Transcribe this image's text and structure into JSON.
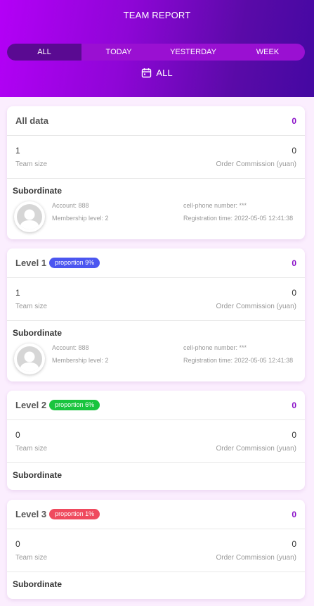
{
  "header": {
    "title": "TEAM REPORT",
    "tabs": [
      {
        "label": "ALL",
        "active": true
      },
      {
        "label": "TODAY",
        "active": false
      },
      {
        "label": "YESTERDAY",
        "active": false
      },
      {
        "label": "WEEK",
        "active": false
      }
    ],
    "date_filter": {
      "icon": "calendar-icon",
      "label": "ALL"
    }
  },
  "colors": {
    "accent": "#8a10c8",
    "level1_badge": "#4b56f0",
    "level2_badge": "#19c43e",
    "level3_badge": "#ef4a5e"
  },
  "cards": [
    {
      "title": "All data",
      "badge": null,
      "value": "0",
      "team_size": "1",
      "team_size_label": "Team size",
      "commission": "0",
      "commission_label": "Order Commission (yuan)",
      "subordinate_label": "Subordinate",
      "member": {
        "account": "Account: 888",
        "membership": "Membership level: 2",
        "phone": "cell-phone number: ***",
        "registration": "Registration time: 2022-05-05 12:41:38"
      }
    },
    {
      "title": "Level 1",
      "badge": "proportion 9%",
      "value": "0",
      "team_size": "1",
      "team_size_label": "Team size",
      "commission": "0",
      "commission_label": "Order Commission (yuan)",
      "subordinate_label": "Subordinate",
      "member": {
        "account": "Account: 888",
        "membership": "Membership level: 2",
        "phone": "cell-phone number: ***",
        "registration": "Registration time: 2022-05-05 12:41:38"
      }
    },
    {
      "title": "Level 2",
      "badge": "proportion 6%",
      "value": "0",
      "team_size": "0",
      "team_size_label": "Team size",
      "commission": "0",
      "commission_label": "Order Commission (yuan)",
      "subordinate_label": "Subordinate",
      "member": null
    },
    {
      "title": "Level 3",
      "badge": "proportion 1%",
      "value": "0",
      "team_size": "0",
      "team_size_label": "Team size",
      "commission": "0",
      "commission_label": "Order Commission (yuan)",
      "subordinate_label": "Subordinate",
      "member": null
    }
  ]
}
